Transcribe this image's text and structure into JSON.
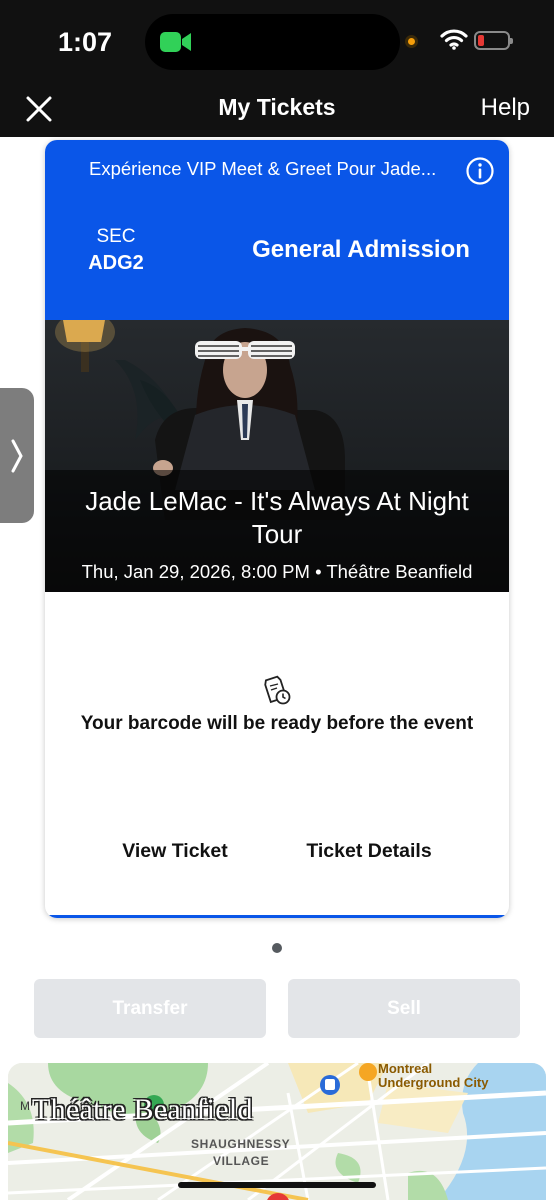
{
  "status_bar": {
    "time": "1:07",
    "facetime_icon": "video-camera-icon",
    "wifi_icon": "wifi-icon",
    "battery_icon": "battery-low-icon",
    "battery_color": "#e53935"
  },
  "nav": {
    "close_icon": "close-icon",
    "title": "My Tickets",
    "help_label": "Help"
  },
  "side_handle": {
    "icon": "chevron-right-icon"
  },
  "ticket": {
    "event_type": "Expérience VIP Meet & Greet Pour Jade...",
    "info_icon": "info-icon",
    "section_label": "SEC",
    "section_value": "ADG2",
    "admission": "General Admission",
    "event_name": "Jade LeMac - It's Always At Night Tour",
    "event_meta": "Thu, Jan 29, 2026, 8:00 PM • Théâtre Beanfield",
    "barcode_icon": "ticket-clock-icon",
    "barcode_message": "Your barcode will be ready before the event",
    "view_ticket_label": "View Ticket",
    "ticket_details_label": "Ticket Details",
    "accent_color": "#0a56e8"
  },
  "actions": {
    "transfer_label": "Transfer",
    "sell_label": "Sell"
  },
  "map": {
    "venue_label": "Théâtre Beanfield",
    "poi_1_line_1": "Montreal",
    "poi_1_line_2": "Underground City",
    "district_line_1": "SHAUGHNESSY",
    "district_line_2": "VILLAGE",
    "partial_label": "M"
  }
}
